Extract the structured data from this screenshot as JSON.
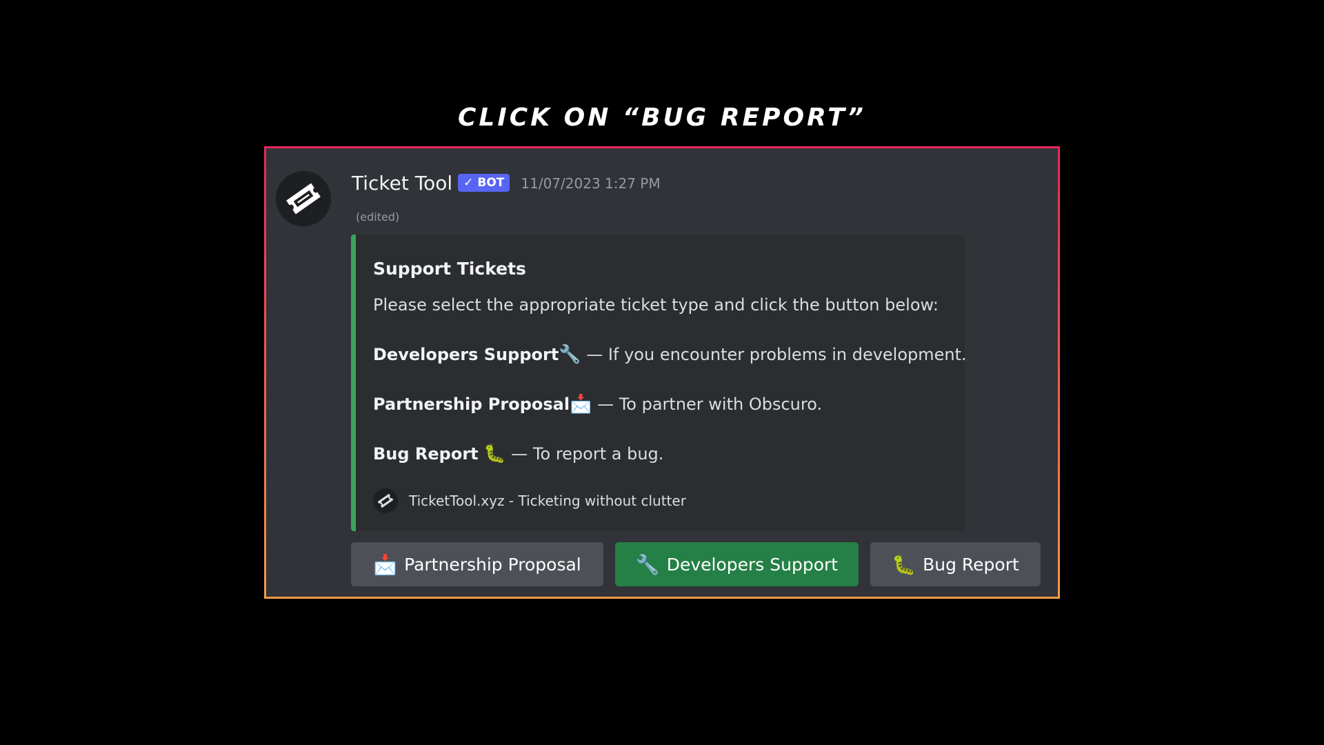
{
  "instruction": "CLICK ON “BUG REPORT”",
  "message": {
    "username": "Ticket Tool",
    "bot_tag": "BOT",
    "bot_check": "✓",
    "timestamp": "11/07/2023 1:27 PM",
    "edited": "(edited)",
    "avatar_icon": "ticket-icon"
  },
  "embed": {
    "accent_color": "#3ba55d",
    "title": "Support Tickets",
    "description": "Please select the appropriate ticket type and click the button below:",
    "lines": [
      {
        "name": "Developers Support",
        "emoji": "🔧",
        "text": " — If you encounter problems in development."
      },
      {
        "name": "Partnership Proposal",
        "emoji": "📩",
        "text": " — To partner with Obscuro."
      },
      {
        "name": "Bug Report",
        "emoji": "🐛",
        "text": " — To report a bug."
      }
    ],
    "footer": "TicketTool.xyz - Ticketing without clutter"
  },
  "buttons": [
    {
      "label": "Partnership Proposal",
      "emoji": "📩",
      "style": "secondary",
      "color": "#4e5058"
    },
    {
      "label": "Developers Support",
      "emoji": "🔧",
      "style": "success",
      "color": "#248046"
    },
    {
      "label": "Bug Report",
      "emoji": "🐛",
      "style": "secondary",
      "color": "#4e5058"
    }
  ]
}
